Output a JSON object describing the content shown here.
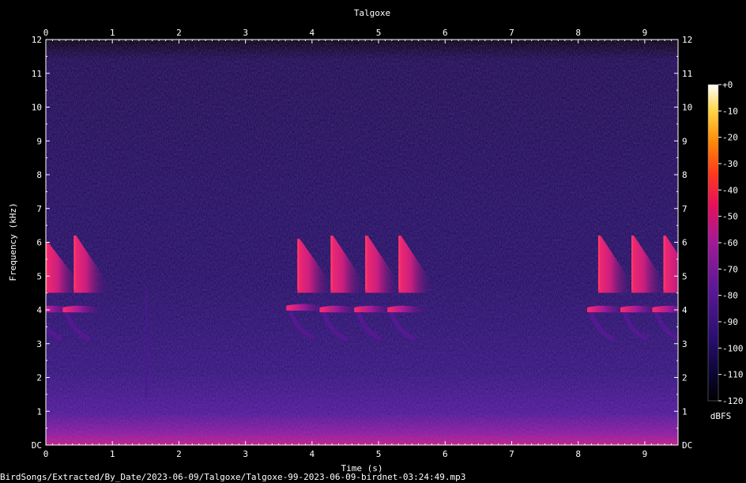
{
  "chart_data": {
    "type": "heatmap",
    "title": "Talgoxe",
    "xlabel": "Time (s)",
    "ylabel": "Frequency (kHz)",
    "xlim": [
      0,
      9.5
    ],
    "ylim": [
      0,
      12
    ],
    "x_ticks": [
      "0",
      "1",
      "2",
      "3",
      "4",
      "5",
      "6",
      "7",
      "8",
      "9"
    ],
    "y_ticks": [
      "DC",
      "1",
      "2",
      "3",
      "4",
      "5",
      "6",
      "7",
      "8",
      "9",
      "10",
      "11",
      "12"
    ],
    "colorbar": {
      "label": "dBFS",
      "range": [
        -120,
        0
      ],
      "ticks": [
        "+0",
        "-10",
        "-20",
        "-30",
        "-40",
        "-50",
        "-60",
        "-70",
        "-80",
        "-90",
        "-100",
        "-110",
        "-120"
      ]
    },
    "grid": false,
    "calls": [
      {
        "t": 0.0,
        "high_khz": [
          4.6,
          6.0
        ],
        "low_khz": 4.0
      },
      {
        "t": 0.42,
        "high_khz": [
          4.6,
          6.2
        ],
        "low_khz": 4.0
      },
      {
        "t": 3.78,
        "high_khz": [
          4.6,
          6.1
        ],
        "low_khz": 4.05
      },
      {
        "t": 4.28,
        "high_khz": [
          4.6,
          6.2
        ],
        "low_khz": 4.0
      },
      {
        "t": 4.8,
        "high_khz": [
          4.6,
          6.2
        ],
        "low_khz": 4.0
      },
      {
        "t": 5.3,
        "high_khz": [
          4.6,
          6.2
        ],
        "low_khz": 4.0
      },
      {
        "t": 8.3,
        "high_khz": [
          4.6,
          6.2
        ],
        "low_khz": 4.0
      },
      {
        "t": 8.8,
        "high_khz": [
          4.6,
          6.2
        ],
        "low_khz": 4.0
      },
      {
        "t": 9.28,
        "high_khz": [
          4.6,
          6.2
        ],
        "low_khz": 4.0
      }
    ],
    "colors": {
      "background": "#000000",
      "noise": "#1e0f5a",
      "call_low": "#6e1a9a",
      "call_high": "#ff2a6e"
    }
  },
  "footer": {
    "file_path": "BirdSongs/Extracted/By_Date/2023-06-09/Talgoxe/Talgoxe-99-2023-06-09-birdnet-03:24:49.mp3"
  }
}
